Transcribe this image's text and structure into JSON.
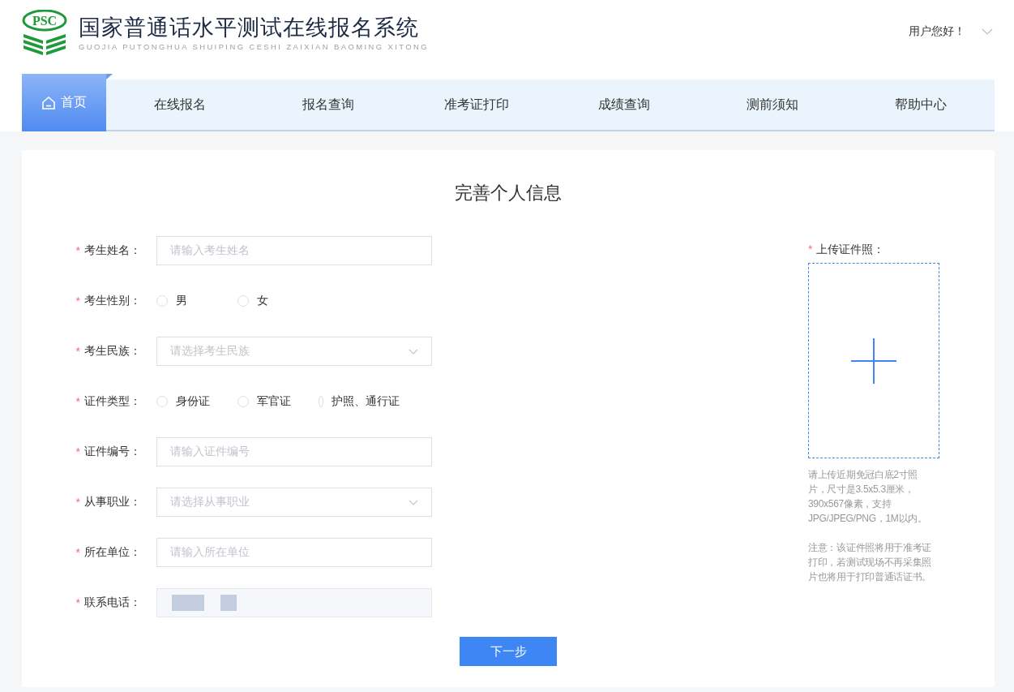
{
  "header": {
    "logo_text": "PSC",
    "title": "国家普通话水平测试在线报名系统",
    "subtitle": "GUOJIA PUTONGHUA SHUIPING CESHI ZAIXIAN BAOMING XITONG",
    "user_greeting": "用户您好！"
  },
  "nav": [
    {
      "label": "首页",
      "selected": true
    },
    {
      "label": "在线报名",
      "selected": false
    },
    {
      "label": "报名查询",
      "selected": false
    },
    {
      "label": "准考证打印",
      "selected": false
    },
    {
      "label": "成绩查询",
      "selected": false
    },
    {
      "label": "测前须知",
      "selected": false
    },
    {
      "label": "帮助中心",
      "selected": false
    }
  ],
  "form": {
    "title": "完善个人信息",
    "fields": [
      {
        "kind": "text",
        "label": "考生姓名：",
        "required_mark": "*",
        "placeholder": "请输入考生姓名"
      },
      {
        "kind": "radio",
        "label": "考生性别：",
        "required_mark": "*",
        "options": [
          {
            "label": "男",
            "selected": false
          },
          {
            "label": "女",
            "selected": false
          }
        ]
      },
      {
        "kind": "select",
        "label": "考生民族：",
        "required_mark": "*",
        "placeholder": "请选择考生民族"
      },
      {
        "kind": "radio",
        "label": "证件类型：",
        "required_mark": "*",
        "options": [
          {
            "label": "身份证",
            "selected": false
          },
          {
            "label": "军官证",
            "selected": false
          },
          {
            "label": "护照、通行证",
            "selected": false
          }
        ]
      },
      {
        "kind": "text",
        "label": "证件编号：",
        "required_mark": "*",
        "placeholder": "请输入证件编号"
      },
      {
        "kind": "select",
        "label": "从事职业：",
        "required_mark": "*",
        "placeholder": "请选择从事职业"
      },
      {
        "kind": "text",
        "label": "所在单位：",
        "required_mark": "*",
        "placeholder": "请输入所在单位"
      },
      {
        "kind": "masked",
        "label": "联系电话：",
        "required_mark": "*",
        "disabled": true
      }
    ],
    "upload": {
      "label": "上传证件照：",
      "required_mark": "*",
      "hint": "请上传近期免冠白底2寸照片，尺寸是3.5x5.3厘米，390x567像素，支持JPG/JPEG/PNG，1M以内。",
      "note": "注意：该证件照将用于准考证打印，若测试现场不再采集照片也将用于打印普通话证书。"
    },
    "next_button": "下一步"
  }
}
